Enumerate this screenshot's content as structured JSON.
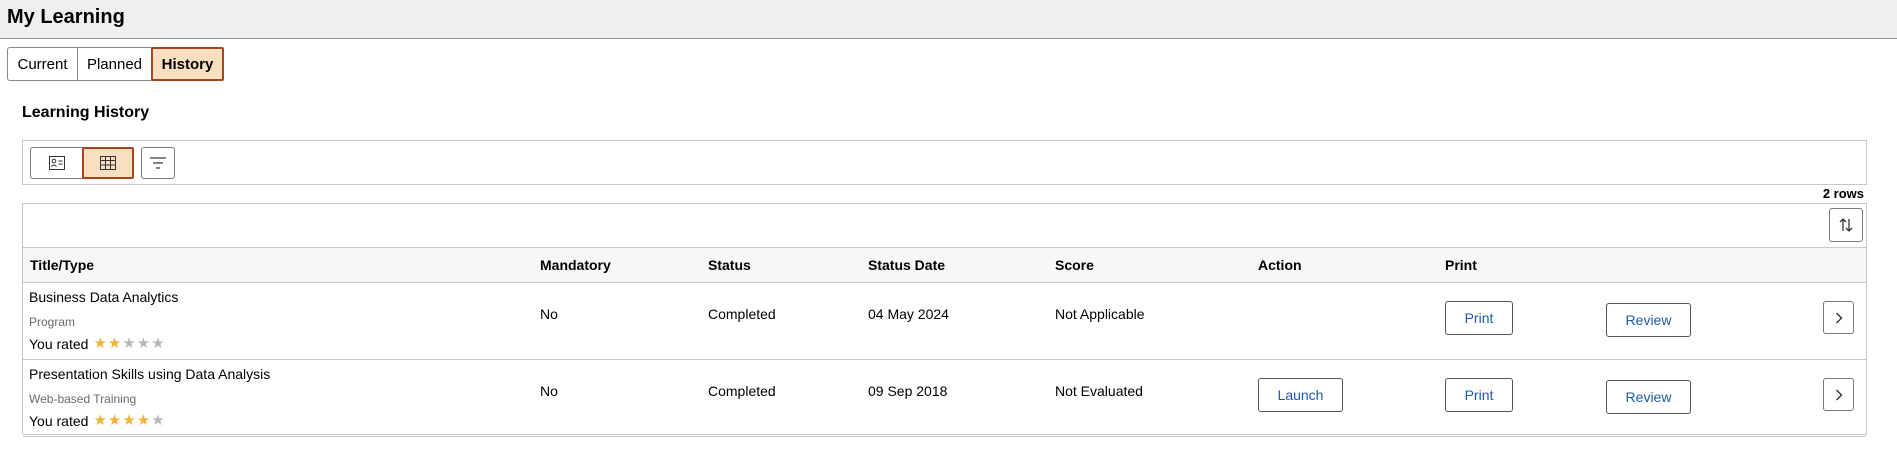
{
  "header": {
    "title": "My Learning"
  },
  "tabs": [
    {
      "label": "Current",
      "active": false
    },
    {
      "label": "Planned",
      "active": false
    },
    {
      "label": "History",
      "active": true
    }
  ],
  "section": {
    "title": "Learning History"
  },
  "toolbar": {
    "card_view_icon": "card-view-icon",
    "grid_view_icon": "grid-view-icon",
    "filter_icon": "filter-icon",
    "active_view": "grid"
  },
  "grid": {
    "row_count": "2 rows",
    "sort_icon": "sort-icon",
    "columns": [
      "Title/Type",
      "Mandatory",
      "Status",
      "Status Date",
      "Score",
      "Action",
      "Print"
    ],
    "rows": [
      {
        "title": "Business Data Analytics",
        "type": "Program",
        "rated_label": "You rated",
        "rating": 2,
        "rating_max": 5,
        "mandatory": "No",
        "status": "Completed",
        "status_date": "04 May 2024",
        "score": "Not Applicable",
        "action": "",
        "print_label": "Print",
        "review_label": "Review"
      },
      {
        "title": "Presentation Skills using Data Analysis",
        "type": "Web-based Training",
        "rated_label": "You rated",
        "rating": 4,
        "rating_max": 5,
        "mandatory": "No",
        "status": "Completed",
        "status_date": "09 Sep 2018",
        "score": "Not Evaluated",
        "action": "Launch",
        "print_label": "Print",
        "review_label": "Review"
      }
    ]
  },
  "colors": {
    "active_bg": "#f9dfbf",
    "active_border": "#a4461f",
    "link_blue": "#1e5aa8",
    "star_on": "#f0b43a",
    "star_off": "#b8b8b8"
  }
}
